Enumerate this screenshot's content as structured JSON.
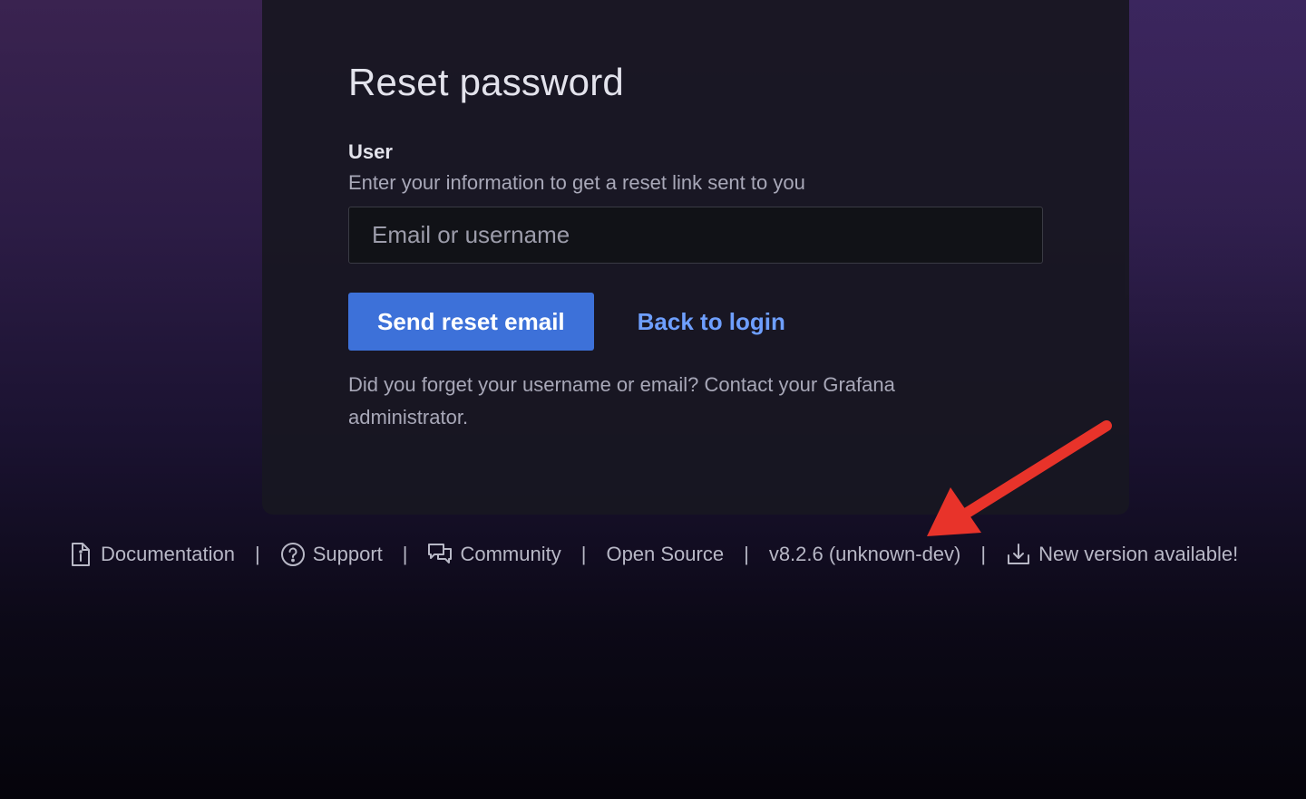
{
  "reset": {
    "title": "Reset password",
    "field_label": "User",
    "field_description": "Enter your information to get a reset link sent to you",
    "input_placeholder": "Email or username",
    "submit_label": "Send reset email",
    "back_label": "Back to login",
    "help_text": "Did you forget your username or email? Contact your Grafana administrator."
  },
  "footer": {
    "items": [
      {
        "label": "Documentation",
        "icon": "document-info-icon"
      },
      {
        "label": "Support",
        "icon": "question-circle-icon"
      },
      {
        "label": "Community",
        "icon": "comments-icon"
      },
      {
        "label": "Open Source",
        "icon": ""
      },
      {
        "label": "v8.2.6 (unknown-dev)",
        "icon": ""
      },
      {
        "label": "New version available!",
        "icon": "download-alt-icon"
      }
    ],
    "separator": "|"
  },
  "colors": {
    "primary_button": "#3d71d9",
    "link": "#6e9fff",
    "annotation_arrow": "#e8332a"
  }
}
